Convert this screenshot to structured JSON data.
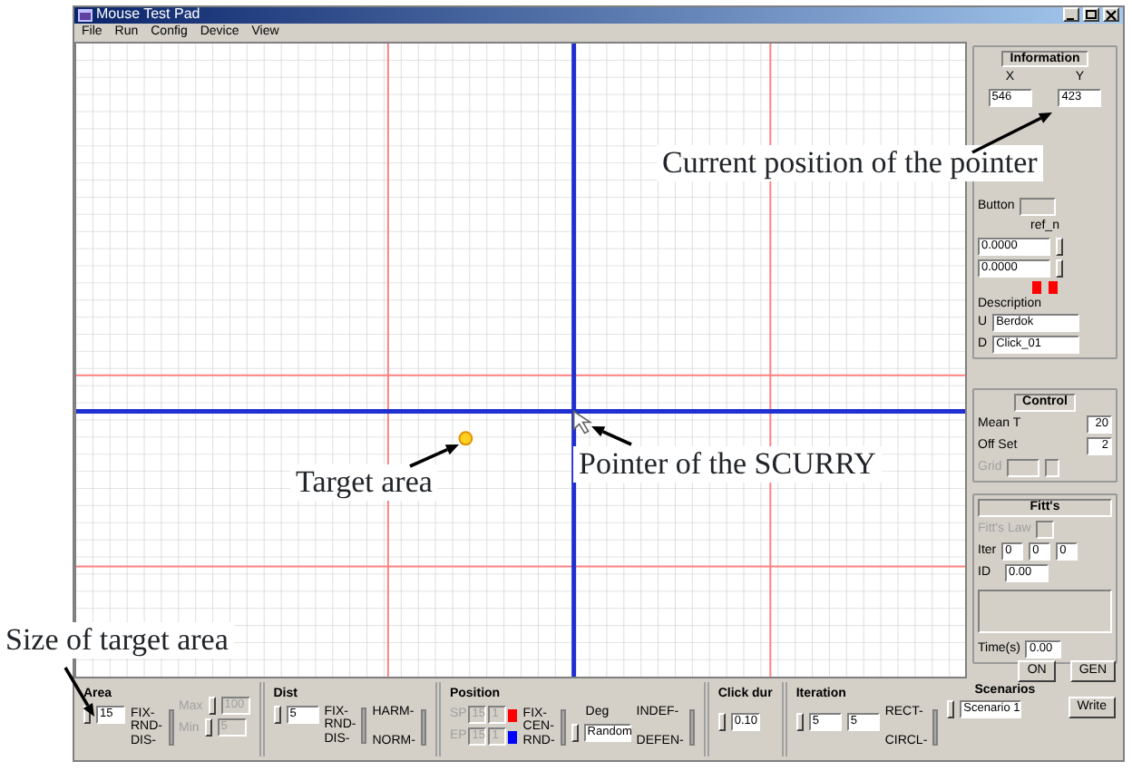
{
  "window": {
    "title": "Mouse Test Pad"
  },
  "menu": [
    "File",
    "Run",
    "Config",
    "Device",
    "View"
  ],
  "information": {
    "title": "Information",
    "x_label": "X",
    "y_label": "Y",
    "x_value": "546",
    "y_value": "423",
    "button_label": "Button",
    "ref_label": "ref_n",
    "ref_values": [
      "0.0000",
      "0.0000"
    ],
    "description_label": "Description",
    "u_label": "U",
    "u_value": "Berdok",
    "d_label": "D",
    "d_value": "Click_01"
  },
  "control": {
    "title": "Control",
    "mean_t_label": "Mean T",
    "mean_t_value": "20",
    "offset_label": "Off Set",
    "offset_value": "2",
    "grid_label": "Grid"
  },
  "fitts": {
    "title": "Fitt's",
    "law_label": "Fitt's Law",
    "iter_label": "Iter",
    "iter_values": [
      "0",
      "0",
      "0"
    ],
    "id_label": "ID",
    "id_value": "0.00",
    "time_label": "Time(s)",
    "time_value": "0.00"
  },
  "run_buttons": [
    "ON",
    "GEN"
  ],
  "bottom": {
    "area": {
      "title": "Area",
      "value": "15",
      "options": [
        "FIX-",
        "RND-",
        "DIS-"
      ],
      "max_label": "Max",
      "max_value": "100",
      "min_label": "Min",
      "min_value": "5"
    },
    "dist": {
      "title": "Dist",
      "value": "5",
      "options": [
        "FIX-",
        "RND-",
        "DIS-"
      ],
      "modes": [
        "HARM-",
        "NORM-"
      ]
    },
    "position": {
      "title": "Position",
      "rows": [
        {
          "label": "SP",
          "values": [
            "15",
            "1"
          ],
          "color": "#ff0000"
        },
        {
          "label": "EP",
          "values": [
            "15",
            "1"
          ],
          "color": "#0000ff"
        }
      ],
      "options": [
        "FIX-",
        "CEN-",
        "RND-"
      ],
      "deg_label": "Deg",
      "deg_value": "Random",
      "modes": [
        "INDEF-",
        "DEFEN-"
      ]
    },
    "click": {
      "title": "Click dur",
      "value": "0.10"
    },
    "iteration": {
      "title": "Iteration",
      "values": [
        "5",
        "5"
      ],
      "shapes": [
        "RECT-",
        "CIRCL-"
      ]
    },
    "scenarios": {
      "title": "Scenarios",
      "value": "Scenario 1",
      "button": "Write"
    }
  },
  "annotations": {
    "pointer_position": "Current position of the pointer",
    "target_area": "Target area",
    "scurry_pointer": "Pointer of the SCURRY",
    "target_size": "Size of target area"
  }
}
